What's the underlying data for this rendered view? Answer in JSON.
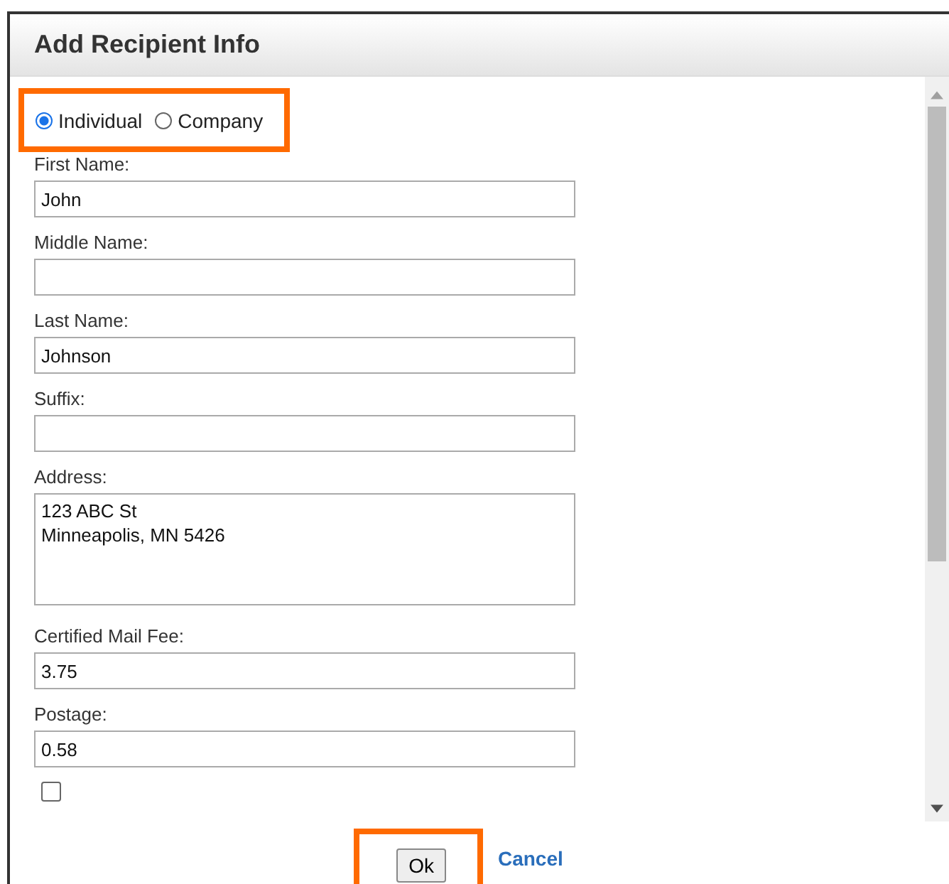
{
  "dialog": {
    "title": "Add Recipient Info"
  },
  "recipient_type": {
    "highlighted": true,
    "options": [
      {
        "label": "Individual",
        "selected": true
      },
      {
        "label": "Company",
        "selected": false
      }
    ]
  },
  "fields": [
    {
      "label": "First Name:",
      "value": "John",
      "kind": "text"
    },
    {
      "label": "Middle Name:",
      "kind": "text"
    },
    {
      "label": "Last Name:",
      "value": "Johnson",
      "kind": "text"
    },
    {
      "label": "Suffix:",
      "kind": "text"
    },
    {
      "label": "Address:",
      "value": "123 ABC St\nMinneapolis, MN 5426",
      "kind": "textarea"
    },
    {
      "label": "Certified Mail Fee:",
      "value": "3.75",
      "kind": "text"
    },
    {
      "label": "Postage:",
      "value": "0.58",
      "kind": "text"
    }
  ],
  "return_receipt": {
    "checked": false
  },
  "buttons": [
    {
      "label": "Ok",
      "kind": "button",
      "highlighted": true
    },
    {
      "label": "Cancel",
      "kind": "link",
      "highlighted": false
    }
  ]
}
